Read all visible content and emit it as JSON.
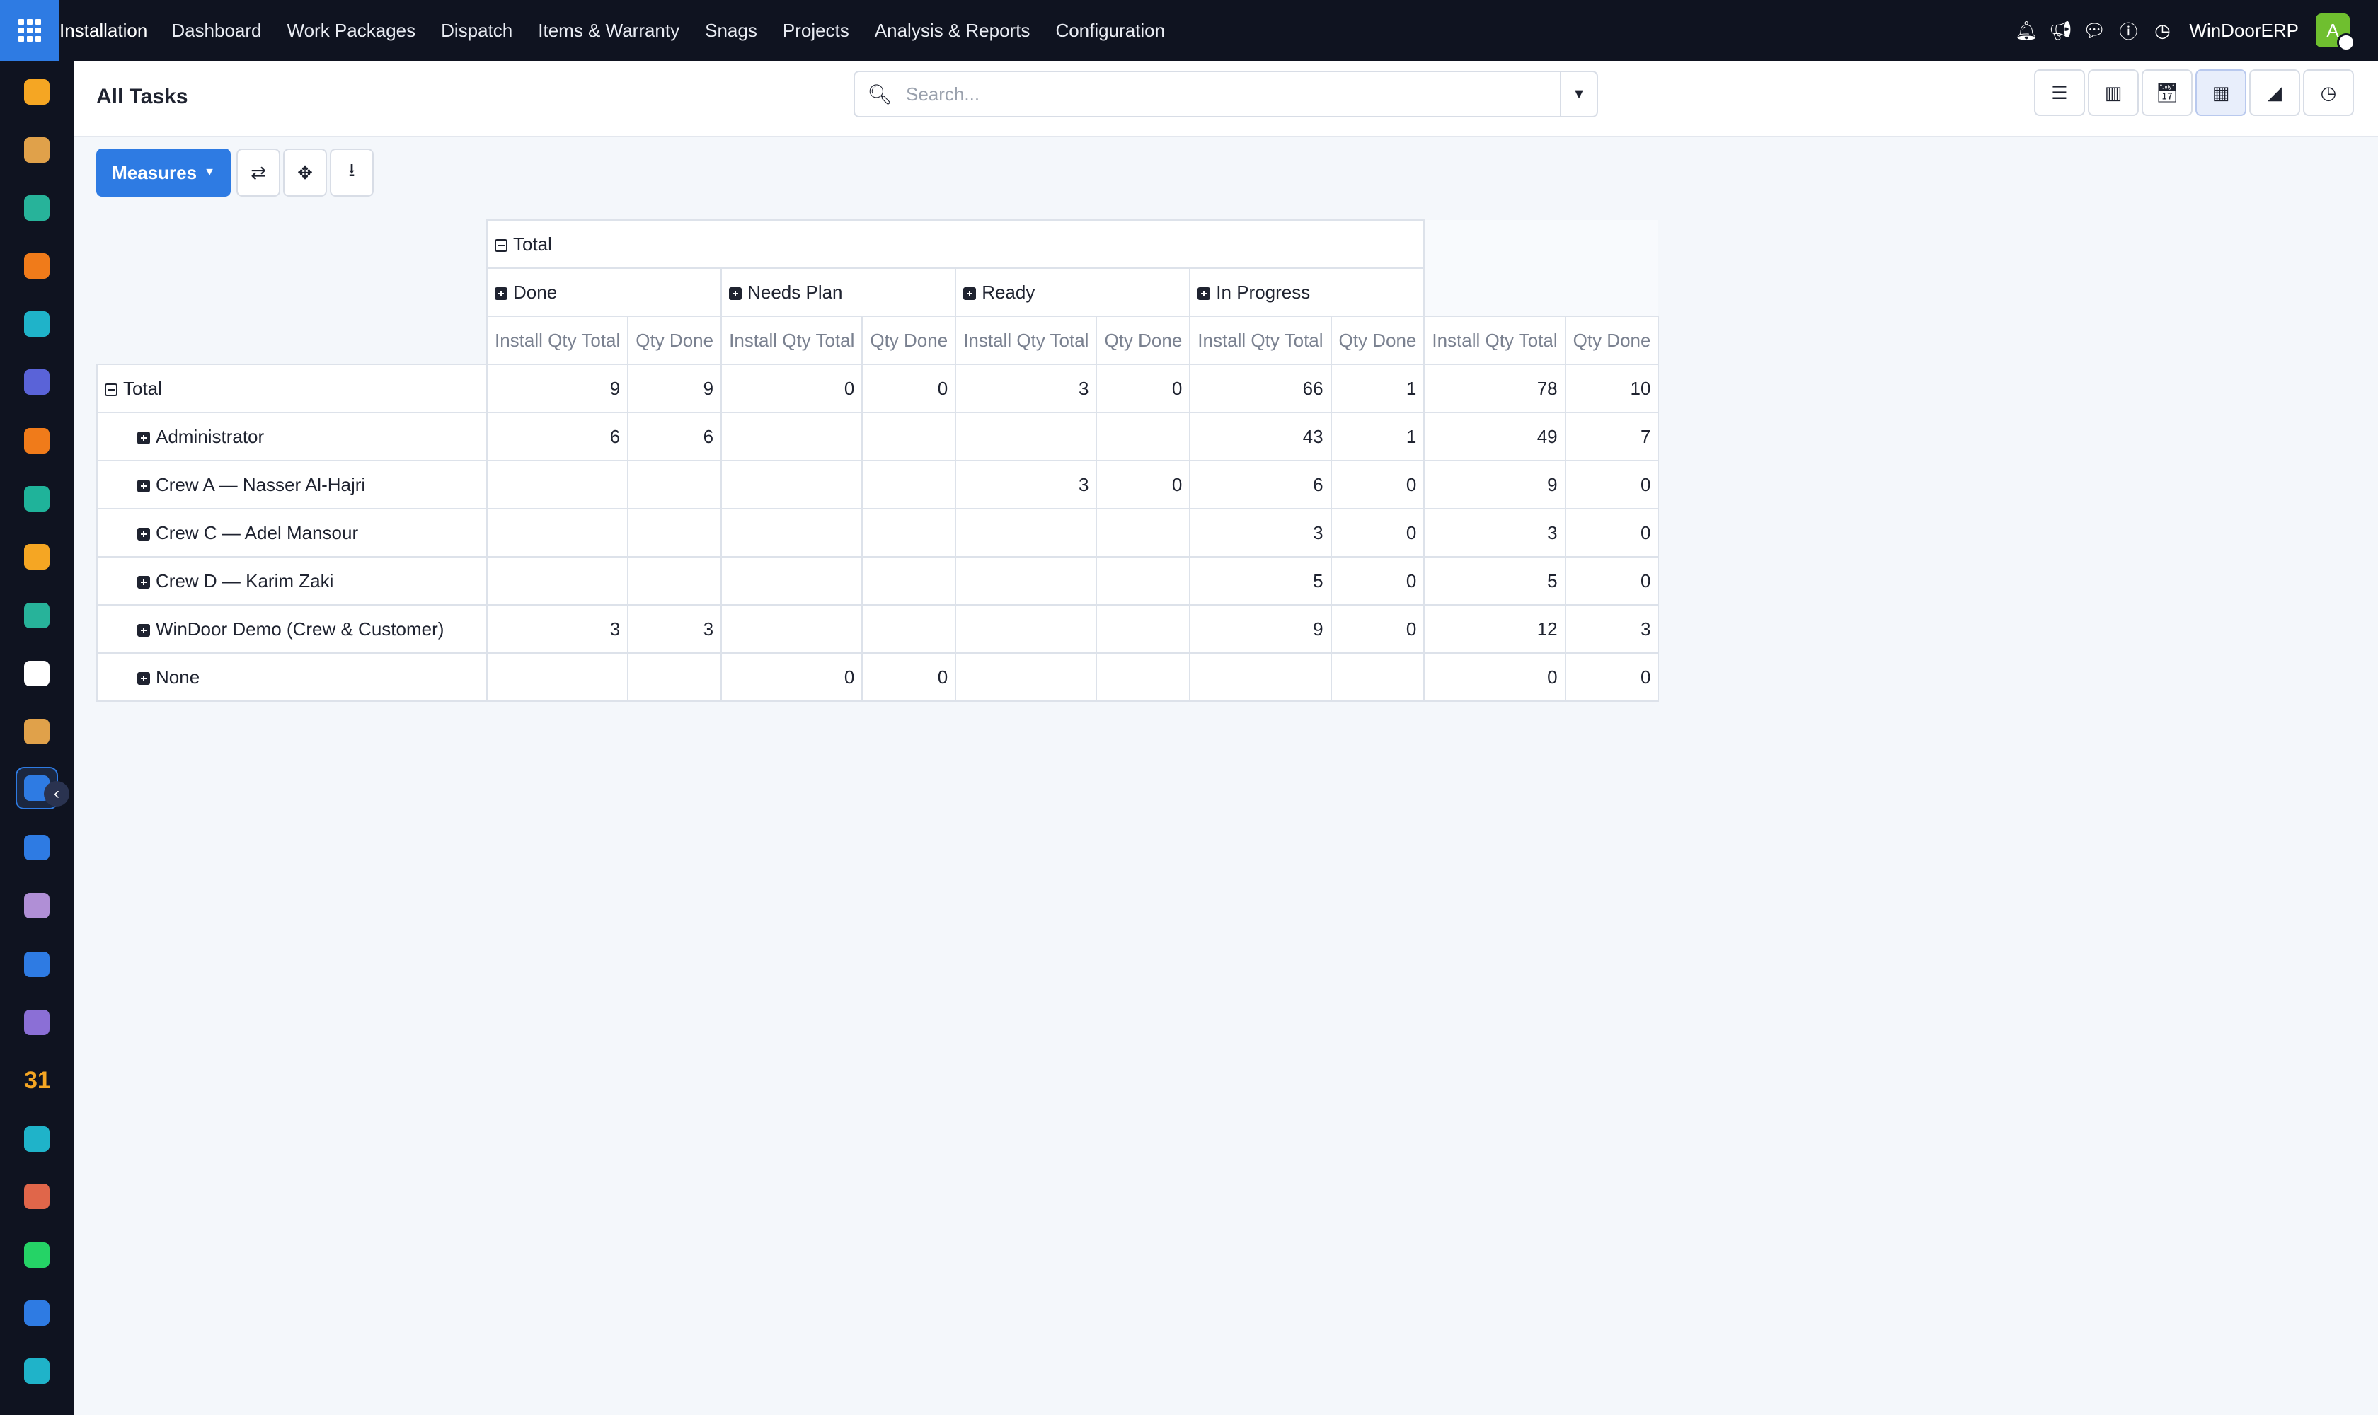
{
  "navbar": {
    "brand": "Installation",
    "menu": [
      "Dashboard",
      "Work Packages",
      "Dispatch",
      "Items & Warranty",
      "Snags",
      "Projects",
      "Analysis & Reports",
      "Configuration"
    ],
    "company": "WinDoorERP",
    "avatar_initial": "A"
  },
  "control_panel": {
    "breadcrumb": "All Tasks",
    "search_placeholder": "Search..."
  },
  "toolbar": {
    "measures_label": "Measures"
  },
  "pivot": {
    "top_header": "Total",
    "columns": [
      {
        "label": "Done"
      },
      {
        "label": "Needs Plan"
      },
      {
        "label": "Ready"
      },
      {
        "label": "In Progress"
      }
    ],
    "measures": [
      "Install Qty Total",
      "Qty Done"
    ],
    "rows": [
      {
        "label": "Total",
        "is_total": true,
        "values": [
          "9",
          "9",
          "0",
          "0",
          "3",
          "0",
          "66",
          "1",
          "78",
          "10"
        ]
      },
      {
        "label": "Administrator",
        "values": [
          "6",
          "6",
          "",
          "",
          "",
          "",
          "43",
          "1",
          "49",
          "7"
        ]
      },
      {
        "label": "Crew A — Nasser Al-Hajri",
        "values": [
          "",
          "",
          "",
          "",
          "3",
          "0",
          "6",
          "0",
          "9",
          "0"
        ]
      },
      {
        "label": "Crew C — Adel Mansour",
        "values": [
          "",
          "",
          "",
          "",
          "",
          "",
          "3",
          "0",
          "3",
          "0"
        ]
      },
      {
        "label": "Crew D — Karim Zaki",
        "values": [
          "",
          "",
          "",
          "",
          "",
          "",
          "5",
          "0",
          "5",
          "0"
        ]
      },
      {
        "label": "WinDoor Demo (Crew & Customer)",
        "values": [
          "3",
          "3",
          "",
          "",
          "",
          "",
          "9",
          "0",
          "12",
          "3"
        ]
      },
      {
        "label": "None",
        "values": [
          "",
          "",
          "0",
          "0",
          "",
          "",
          "",
          "",
          "0",
          "0"
        ]
      }
    ]
  },
  "sidebar_icon_colors": [
    "#f5a623",
    "#e0a14a",
    "#27b39a",
    "#f07b1a",
    "#1fb3c9",
    "#5a63d8",
    "#f07b1a",
    "#1fb39a",
    "#f5a623",
    "#27b39a",
    "#ffffff",
    "#e0a14a",
    "#2e7be3",
    "#2e7be3",
    "#b08fd6",
    "#2e7be3",
    "#8b6fd6",
    "#f5a623",
    "#1fb3c9",
    "#e0664a",
    "#25d366",
    "#2e7be3",
    "#1fb3c9"
  ],
  "accent_color": "#2e7be3"
}
